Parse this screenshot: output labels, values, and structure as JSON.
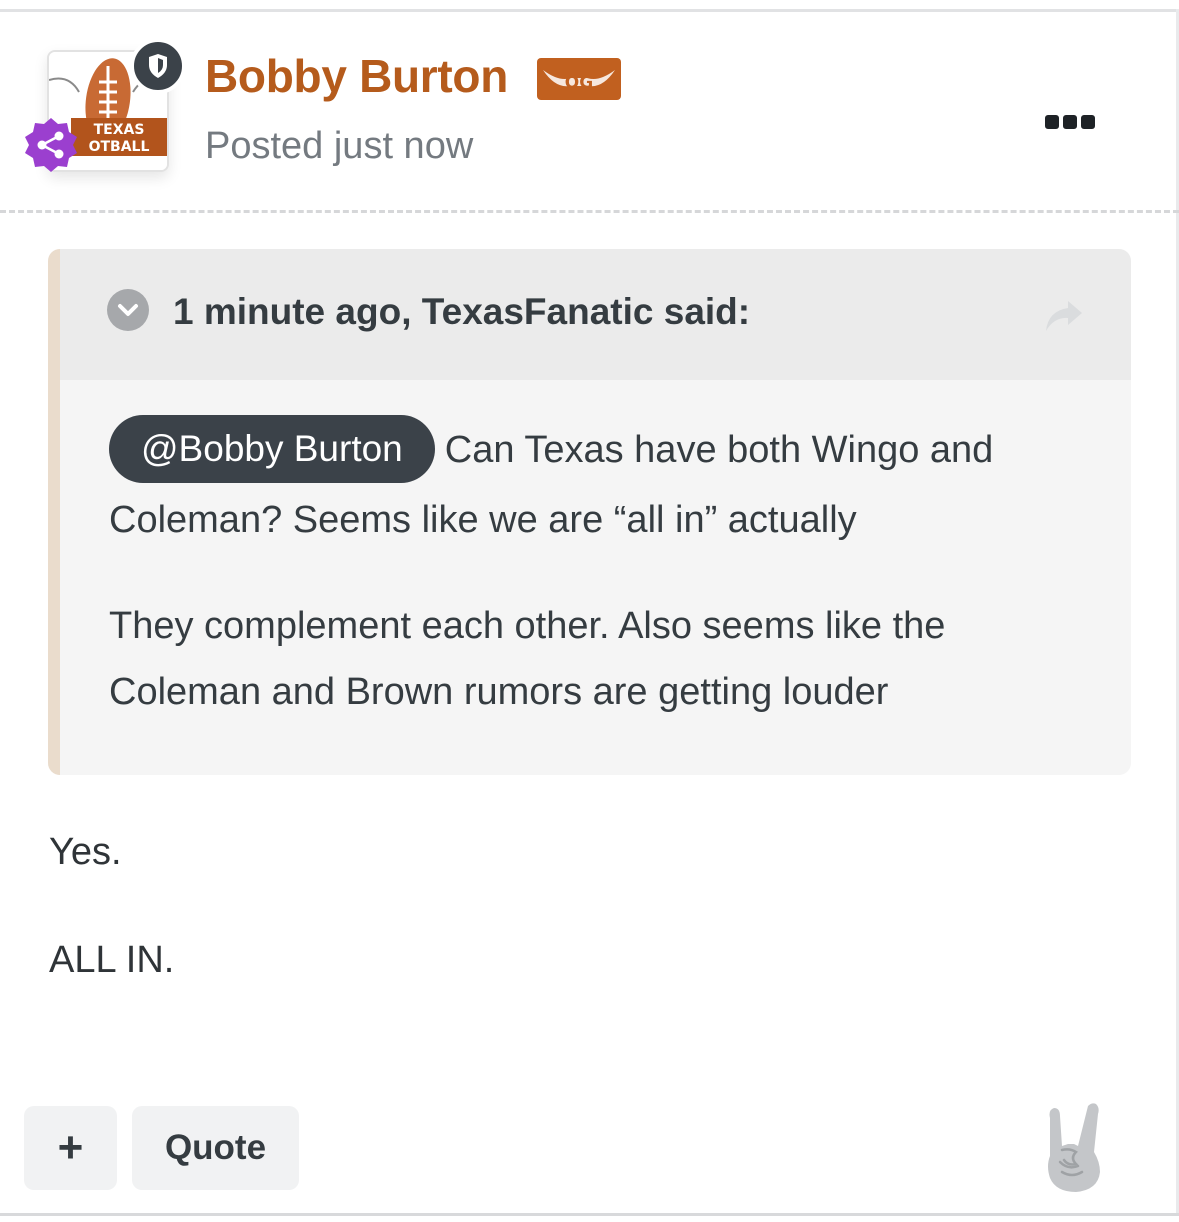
{
  "post": {
    "author_name": "Bobby Burton",
    "author_badge": "OG",
    "posted_text": "Posted just now",
    "avatar_lines": [
      "TEXAS",
      "OTBALL"
    ],
    "reply_lines": [
      "Yes.",
      "ALL IN."
    ]
  },
  "quote": {
    "citation": "1 minute ago, TexasFanatic said:",
    "mention": "@Bobby Burton",
    "line1_rest": "Can Texas have both Wingo and",
    "line2": "Coleman? Seems like we are “all in” actually",
    "para2_line1": "They complement each other. Also seems like the",
    "para2_line2": "Coleman and Brown rumors are getting louder"
  },
  "actions": {
    "plus_label": "+",
    "quote_label": "Quote"
  },
  "colors": {
    "author": "#b55b1c",
    "mention_bg": "#3b4249",
    "quote_bar": "#eadccc",
    "badge_purple": "#9b3fcf"
  },
  "icons": {
    "shield": "shield-icon",
    "share_network": "share-network-icon",
    "more": "ellipsis-icon",
    "collapse": "chevron-down-icon",
    "share": "share-arrow-icon",
    "reaction": "horns-hand-icon"
  }
}
